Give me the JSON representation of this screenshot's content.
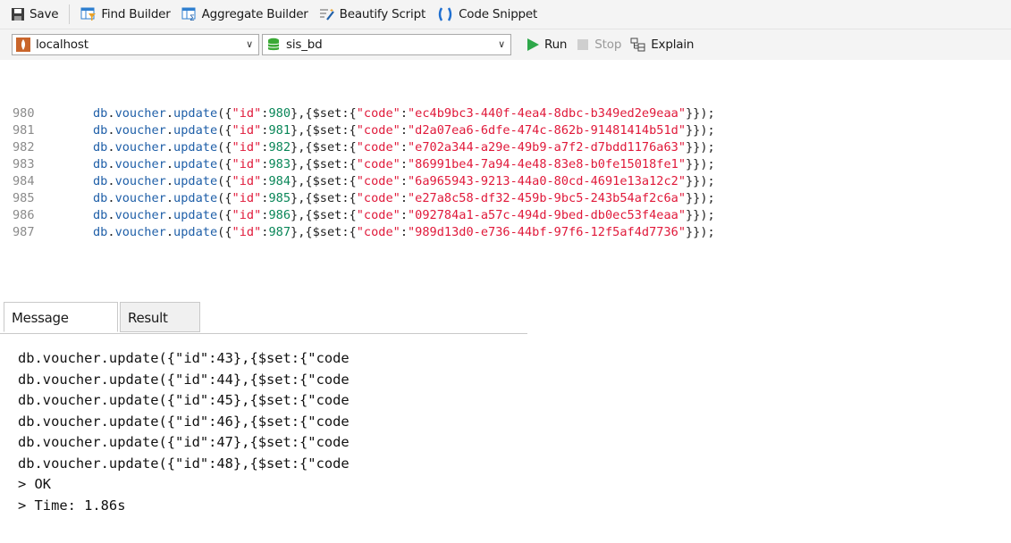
{
  "toolbar": {
    "save": "Save",
    "find_builder": "Find Builder",
    "aggregate_builder": "Aggregate Builder",
    "beautify_script": "Beautify Script",
    "code_snippet": "Code Snippet"
  },
  "connection": {
    "server": "localhost",
    "database": "sis_bd",
    "run": "Run",
    "stop": "Stop",
    "explain": "Explain"
  },
  "editor": {
    "lines": [
      {
        "num": "980",
        "id": "980",
        "code": "ec4b9bc3-440f-4ea4-8dbc-b349ed2e9eaa"
      },
      {
        "num": "981",
        "id": "981",
        "code": "d2a07ea6-6dfe-474c-862b-91481414b51d"
      },
      {
        "num": "982",
        "id": "982",
        "code": "e702a344-a29e-49b9-a7f2-d7bdd1176a63"
      },
      {
        "num": "983",
        "id": "983",
        "code": "86991be4-7a94-4e48-83e8-b0fe15018fe1"
      },
      {
        "num": "984",
        "id": "984",
        "code": "6a965943-9213-44a0-80cd-4691e13a12c2"
      },
      {
        "num": "985",
        "id": "985",
        "code": "e27a8c58-df32-459b-9bc5-243b54af2c6a"
      },
      {
        "num": "986",
        "id": "986",
        "code": "092784a1-a57c-494d-9bed-db0ec53f4eaa"
      },
      {
        "num": "987",
        "id": "987",
        "code": "989d13d0-e736-44bf-97f6-12f5af4d7736"
      }
    ]
  },
  "tabs": {
    "message": "Message",
    "result": "Result"
  },
  "messages": {
    "lines": [
      "db.voucher.update({\"id\":43},{$set:{\"code",
      "db.voucher.update({\"id\":44},{$set:{\"code",
      "db.voucher.update({\"id\":45},{$set:{\"code",
      "db.voucher.update({\"id\":46},{$set:{\"code",
      "db.voucher.update({\"id\":47},{$set:{\"code",
      "db.voucher.update({\"id\":48},{$set:{\"code",
      "> OK",
      "> Time: 1.86s"
    ]
  },
  "colors": {
    "identifier": "#1f5fa8",
    "string": "#e0193a",
    "number": "#098658",
    "line_number": "#8a8a8a",
    "run_green": "#2ea84a",
    "db_green": "#3aa935"
  }
}
